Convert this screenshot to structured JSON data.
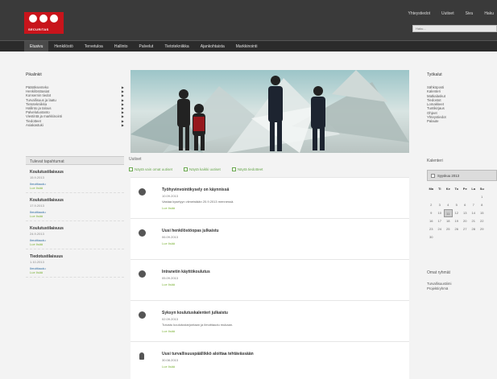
{
  "header": {
    "logo_text": "SECURITAS",
    "top_links": [
      "Yhteystiedot",
      "Uutiset",
      "Sivu",
      "Haku"
    ],
    "search_placeholder": "Haku..."
  },
  "nav": {
    "items": [
      "Etusivu",
      "Henkilöstö",
      "Tervetuloa",
      "Hallinto",
      "Palvelut",
      "Tietotekniikka",
      "Ajankohtaista",
      "Markkinointi"
    ]
  },
  "left": {
    "links_title": "Pikalinkit",
    "links": [
      "Päätöksenteko",
      "Henkilöstöasiat",
      "Konsernin tiedot",
      "Turvallisuus ja laatu",
      "Tietotekniikka",
      "Hallinto ja talous",
      "Palvelutuotanto",
      "Viestintä ja markkinointi",
      "Tiedotteet",
      "Asiakastuki"
    ],
    "calendar_title": "Tulevat tapahtumat",
    "events": [
      {
        "title": "Koulutustilaisuus",
        "sub": "15.9.2013",
        "link": "Ilmoittaudu",
        "more": "Lue lisää"
      },
      {
        "title": "Koulutustilaisuus",
        "sub": "17.9.2013",
        "link": "Ilmoittaudu",
        "more": "Lue lisää"
      },
      {
        "title": "Koulutustilaisuus",
        "sub": "24.9.2013",
        "link": "Ilmoittaudu",
        "more": "Lue lisää"
      },
      {
        "title": "Tiedotustilaisuus",
        "sub": "1.10.2013",
        "link": "Ilmoittaudu",
        "more": "Lue lisää"
      }
    ]
  },
  "main": {
    "news_title": "Uutiset",
    "filters": [
      "Näytä vain omat uutiset",
      "Näytä kaikki uutiset",
      "Näytä tiedotteet"
    ],
    "news": [
      {
        "icon": "info-icon",
        "title": "Työhyvinvointikysely on käynnissä",
        "date": "10.09.2013",
        "desc": "Vastaa kyselyyn viimeistään 20.9.2013 mennessä.",
        "more": "Lue lisää"
      },
      {
        "icon": "info-icon",
        "title": "Uusi henkilöstöopas julkaistu",
        "date": "06.09.2013",
        "desc": "",
        "more": "Lue lisää"
      },
      {
        "icon": "info-icon",
        "title": "Intranetin käyttökoulutus",
        "date": "05.09.2013",
        "desc": "",
        "more": "Lue lisää"
      },
      {
        "icon": "info-icon",
        "title": "Syksyn koulutuskalenteri julkaistu",
        "date": "02.09.2013",
        "desc": "Tutustu koulutustarjontaan ja ilmoittaudu mukaan.",
        "more": "Lue lisää"
      },
      {
        "icon": "person-icon",
        "title": "Uusi turvallisuuspäällikkö aloittaa tehtävässään",
        "date": "30.08.2013",
        "desc": "",
        "more": "Lue lisää"
      }
    ]
  },
  "right": {
    "links_title": "Työkalut",
    "links": [
      "Sähköposti",
      "Kalenteri",
      "Matkalaskut",
      "Tiedostot",
      "Lomakkeet",
      "Tuntikirjaus",
      "Ohjeet",
      "Yhteystiedot",
      "Palaute"
    ],
    "calendar_title": "Kalenteri",
    "calendar_month": "Syyskuu 2013",
    "weekdays": [
      "Ma",
      "Ti",
      "Ke",
      "To",
      "Pe",
      "La",
      "Su"
    ],
    "weeks": [
      [
        "",
        "",
        "",
        "",
        "",
        "",
        "1"
      ],
      [
        "2",
        "3",
        "4",
        "5",
        "6",
        "7",
        "8"
      ],
      [
        "9",
        "10",
        "11",
        "12",
        "13",
        "14",
        "15"
      ],
      [
        "16",
        "17",
        "18",
        "19",
        "20",
        "21",
        "22"
      ],
      [
        "23",
        "24",
        "25",
        "26",
        "27",
        "28",
        "29"
      ],
      [
        "30",
        "",
        "",
        "",
        "",
        "",
        ""
      ]
    ],
    "today": "11",
    "group_title": "Omat ryhmät",
    "groups": [
      "Turvallisuustiimi",
      "Projektiryhmä"
    ]
  }
}
